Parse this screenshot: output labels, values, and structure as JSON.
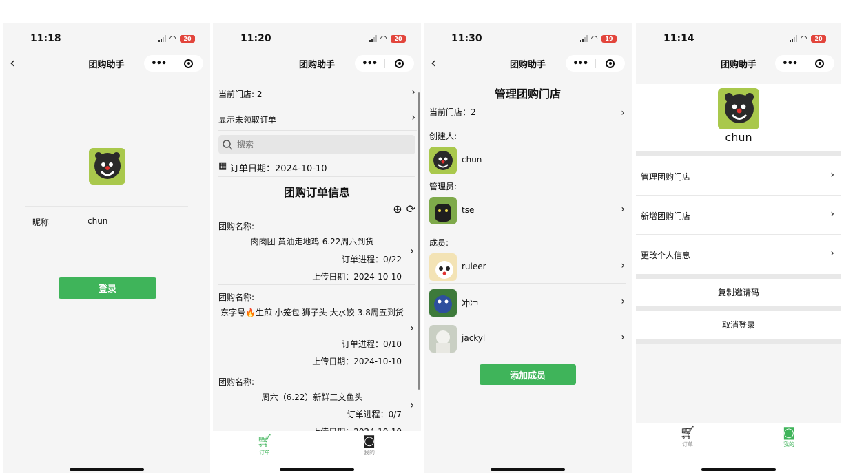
{
  "colors": {
    "accent": "#3fb45a",
    "battery": "#e2453c"
  },
  "screens": [
    {
      "time": "11:18",
      "battery": "20",
      "title": "团购助手",
      "nickname_label": "昵称",
      "nickname_value": "chun",
      "login_label": "登录"
    },
    {
      "time": "11:20",
      "battery": "20",
      "title": "团购助手",
      "current_store": "当前门店: 2",
      "show_unclaimed": "显示未领取订单",
      "search_placeholder": "搜索",
      "order_date": "订单日期：2024-10-10",
      "section_title": "团购订单信息",
      "orders": [
        {
          "label": "团购名称:",
          "name": "肉肉团 黄油走地鸡-6.22周六到货",
          "progress": "订单进程：0/22",
          "upload": "上传日期：2024-10-10"
        },
        {
          "label": "团购名称:",
          "name": "东字号🔥生煎 小笼包 狮子头 大水饺-3.8周五到货",
          "progress": "订单进程：0/10",
          "upload": "上传日期：2024-10-10"
        },
        {
          "label": "团购名称:",
          "name": "周六（6.22）新鲜三文鱼头",
          "progress": "订单进程：0/7",
          "upload": "上传日期：2024-10-10"
        }
      ],
      "tabs": [
        {
          "label": "订单"
        },
        {
          "label": "我的"
        }
      ]
    },
    {
      "time": "11:30",
      "battery": "19",
      "title": "团购助手",
      "page_title": "管理团购门店",
      "current_store": "当前门店：2",
      "creator_label": "创建人:",
      "creator": "chun",
      "admin_label": "管理员:",
      "admins": [
        {
          "name": "tse"
        }
      ],
      "members_label": "成员:",
      "members": [
        {
          "name": "ruleer"
        },
        {
          "name": "冲冲"
        },
        {
          "name": "jackyl"
        }
      ],
      "add_member_label": "添加成员"
    },
    {
      "time": "11:14",
      "battery": "20",
      "title": "团购助手",
      "username": "chun",
      "menu": [
        {
          "label": "管理团购门店"
        },
        {
          "label": "新增团购门店"
        },
        {
          "label": "更改个人信息"
        }
      ],
      "copy_invite": "复制邀请码",
      "logout": "取消登录",
      "tabs": [
        {
          "label": "订单"
        },
        {
          "label": "我的"
        }
      ]
    }
  ]
}
